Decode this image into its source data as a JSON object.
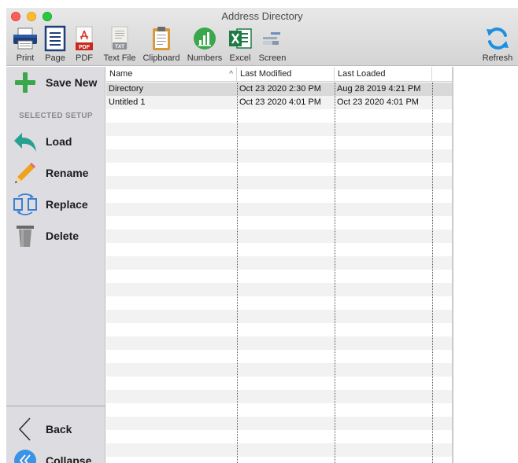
{
  "window": {
    "title": "Address Directory"
  },
  "toolbar": {
    "print": "Print",
    "page": "Page",
    "pdf": "PDF",
    "pdf_badge": "PDF",
    "text_file": "Text File",
    "txt_badge": "TXT",
    "clipboard": "Clipboard",
    "numbers": "Numbers",
    "excel": "Excel",
    "screen": "Screen",
    "refresh": "Refresh"
  },
  "sidebar": {
    "save_new": "Save New",
    "section_label": "SELECTED SETUP",
    "load": "Load",
    "rename": "Rename",
    "replace": "Replace",
    "delete": "Delete",
    "back": "Back",
    "collapse": "Collapse"
  },
  "table": {
    "columns": [
      "Name",
      "Last Modified",
      "Last Loaded"
    ],
    "sort_indicator": "^",
    "rows": [
      {
        "name": "Directory",
        "modified": "Oct 23 2020 2:30 PM",
        "loaded": "Aug 28 2019 4:21 PM",
        "selected": true
      },
      {
        "name": "Untitled 1",
        "modified": "Oct 23 2020 4:01 PM",
        "loaded": "Oct 23 2020 4:01 PM",
        "selected": false
      }
    ]
  },
  "colors": {
    "accent_green": "#3aa84a",
    "accent_blue": "#1d8fe0",
    "sidebar_bg": "#dcdce1",
    "selected_row": "#d9d9d9"
  }
}
